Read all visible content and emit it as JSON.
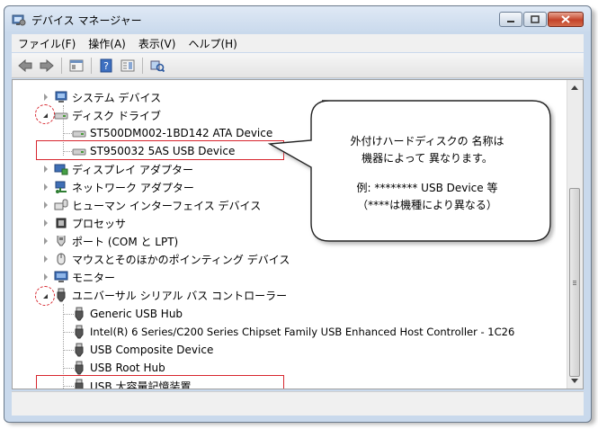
{
  "window": {
    "title": "デバイス マネージャー"
  },
  "menu": [
    "ファイル(F)",
    "操作(A)",
    "表示(V)",
    "ヘルプ(H)"
  ],
  "toolbar": [
    "back-icon",
    "forward-icon",
    "properties-icon",
    "help-icon",
    "details-icon",
    "scan-hardware-icon"
  ],
  "tree": {
    "system_devices": "システム デバイス",
    "disk_drives": "ディスク ドライブ",
    "disk1": "ST500DM002-1BD142 ATA Device",
    "disk2": "ST950032 5AS USB Device",
    "display_adapters": "ディスプレイ アダプター",
    "network_adapters": "ネットワーク アダプター",
    "hid": "ヒューマン インターフェイス デバイス",
    "processors": "プロセッサ",
    "ports": "ポート (COM と LPT)",
    "mice": "マウスとそのほかのポインティング デバイス",
    "monitors": "モニター",
    "usb_controllers": "ユニバーサル シリアル バス コントローラー",
    "usb_hub": "Generic USB Hub",
    "usb_host": "Intel(R) 6 Series/C200 Series Chipset Family USB Enhanced Host Controller - 1C26",
    "usb_composite": "USB Composite Device",
    "usb_root_hub": "USB Root Hub",
    "usb_storage": "USB 大容量記憶装置"
  },
  "callout": {
    "line1": "外付けハードディスクの 名称は",
    "line2": "機器によって 異なります。",
    "line3": "例: ******** USB  Device 等",
    "line4": "（****は機種により異なる）"
  },
  "colors": {
    "highlight": "#d7262e",
    "title_bg": "#c9d9ec"
  }
}
